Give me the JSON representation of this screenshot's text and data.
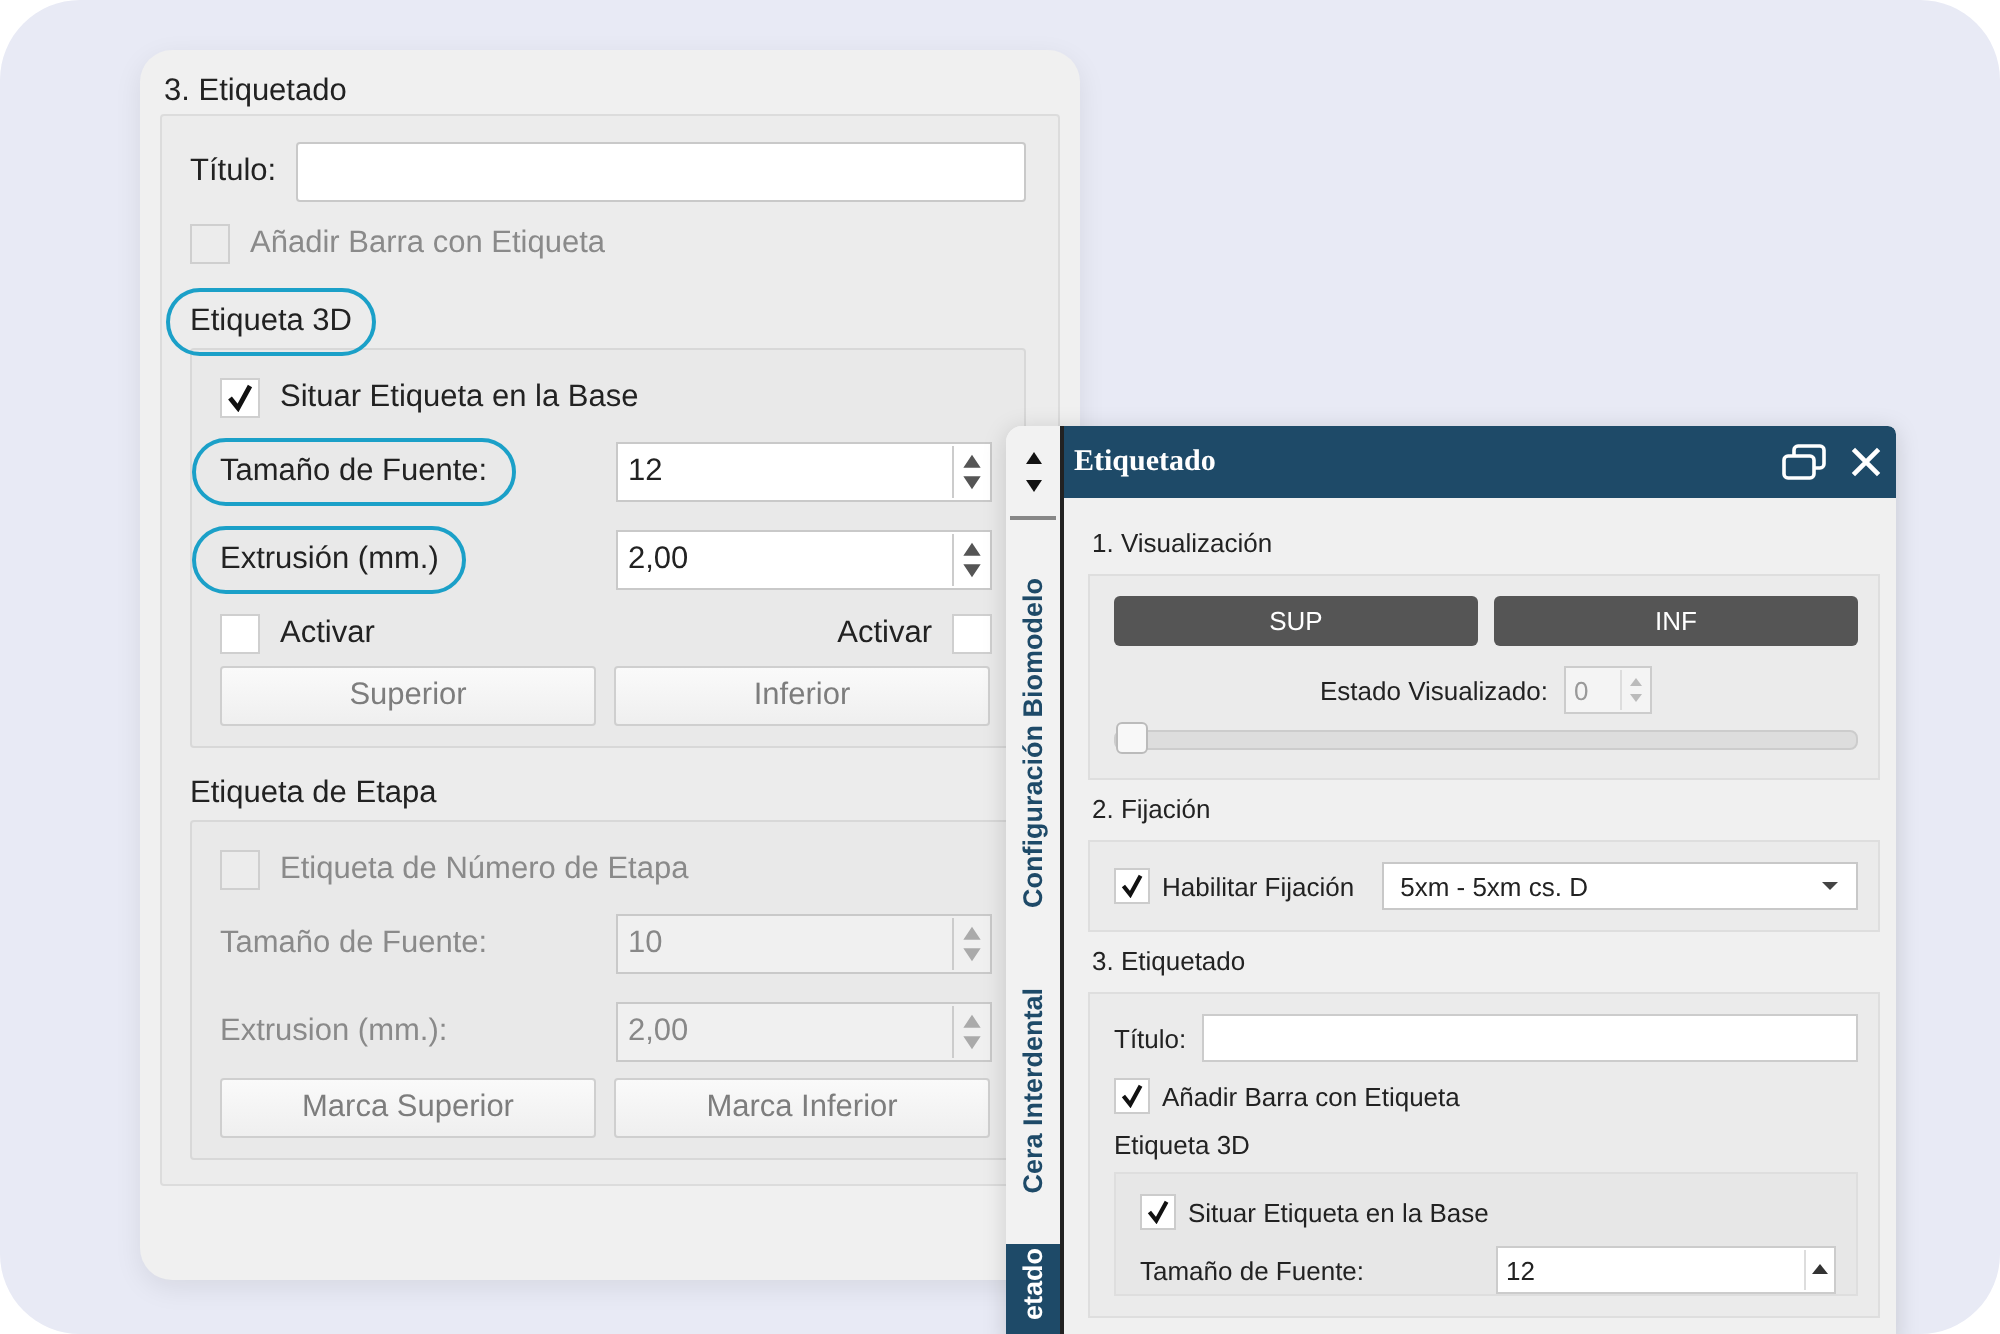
{
  "left_panel": {
    "section_title": "3. Etiquetado",
    "title_field": {
      "label": "Título:"
    },
    "add_bar": {
      "label": "Añadir Barra con Etiqueta",
      "checked": false,
      "disabled": true
    },
    "label_3d": {
      "heading": "Etiqueta 3D",
      "highlighted": true,
      "place_on_base": {
        "label": "Situar Etiqueta en la Base",
        "checked": true,
        "disabled": false
      },
      "fields": [
        {
          "label": "Tamaño de Fuente:",
          "value": "12",
          "highlighted": true,
          "disabled": false
        },
        {
          "label": "Extrusión (mm.)",
          "value": "2,00",
          "highlighted": true,
          "disabled": false
        }
      ],
      "activate_left": {
        "label": "Activar",
        "checked": false
      },
      "activate_right": {
        "label": "Activar",
        "checked": false
      },
      "buttons": [
        {
          "label": "Superior",
          "disabled": true
        },
        {
          "label": "Inferior",
          "disabled": true
        }
      ]
    },
    "stage_label": {
      "heading": "Etiqueta de Etapa",
      "stage_number": {
        "label": "Etiqueta de Número de Etapa",
        "checked": false,
        "disabled": true
      },
      "fields": [
        {
          "label": "Tamaño de Fuente:",
          "value": "10",
          "highlighted": false,
          "disabled": true
        },
        {
          "label": "Extrusion (mm.):",
          "value": "2,00",
          "highlighted": false,
          "disabled": true
        }
      ],
      "buttons": [
        {
          "label": "Marca Superior",
          "disabled": true
        },
        {
          "label": "Marca Inferior",
          "disabled": true
        }
      ]
    }
  },
  "window": {
    "title": "Etiquetado",
    "side_tabs": [
      {
        "label": "Configuración Biomodelo",
        "selected": false
      },
      {
        "label": "Cera Interdental",
        "selected": false
      },
      {
        "label": "etado",
        "selected": true
      }
    ],
    "visualization": {
      "heading": "1. Visualización",
      "buttons": [
        "SUP",
        "INF"
      ],
      "state_label": "Estado Visualizado:",
      "state_value": "0",
      "level": 0
    },
    "fixation": {
      "heading": "2. Fijación",
      "enable": {
        "label": "Habilitar Fijación",
        "checked": true
      },
      "dropdown": "5xm - 5xm cs. D"
    },
    "labeling": {
      "heading": "3. Etiquetado",
      "title_label": "Título:",
      "add_bar": {
        "label": "Añadir Barra con Etiqueta",
        "checked": true
      },
      "subheading": "Etiqueta 3D",
      "place_on_base": {
        "label": "Situar Etiqueta en la Base",
        "checked": true
      },
      "font_size": {
        "label": "Tamaño de Fuente:",
        "value": "12"
      }
    }
  }
}
